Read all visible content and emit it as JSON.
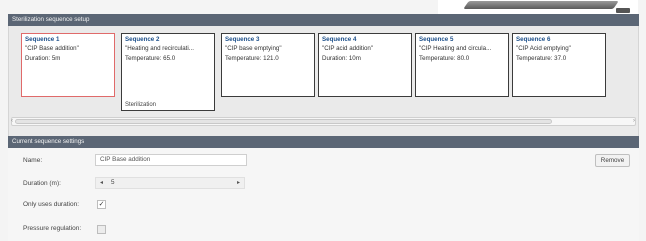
{
  "setup_header": "Sterilization sequence setup",
  "current_header": "Current sequence settings",
  "sequences": [
    {
      "title": "Sequence 1",
      "line1": "\"CIP Base addition\"",
      "line2": "Duration: 5m",
      "footer": ""
    },
    {
      "title": "Sequence 2",
      "line1": "\"Heating and recirculati...",
      "line2": "Temperature: 65.0",
      "footer": "Sterilization"
    },
    {
      "title": "Sequence 3",
      "line1": "\"CIP base emptying\"",
      "line2": "Temperature: 121.0",
      "footer": ""
    },
    {
      "title": "Sequence 4",
      "line1": "\"CIP acid addition\"",
      "line2": "Duration: 10m",
      "footer": ""
    },
    {
      "title": "Sequence 5",
      "line1": "\"CIP Heating and circula...",
      "line2": "Temperature: 80.0",
      "footer": ""
    },
    {
      "title": "Sequence 6",
      "line1": "\"CIP Acid emptying\"",
      "line2": "Temperature: 37.0",
      "footer": ""
    }
  ],
  "settings": {
    "name_label": "Name:",
    "name_value": "CIP Base addition",
    "duration_label": "Duration (m):",
    "duration_value": "5",
    "only_duration_label": "Only uses duration:",
    "only_duration_checked": true,
    "check_mark": "✓",
    "pressure_label": "Pressure regulation:",
    "pressure_checked": false,
    "remove_label": "Remove"
  },
  "icons": {
    "scroll_left": "‹",
    "scroll_right": "›",
    "dec": "◂",
    "inc": "▸"
  },
  "colors": {
    "header_bg": "#5b6675",
    "selected_border": "#e06a6a",
    "title_blue": "#1c4f8a"
  }
}
